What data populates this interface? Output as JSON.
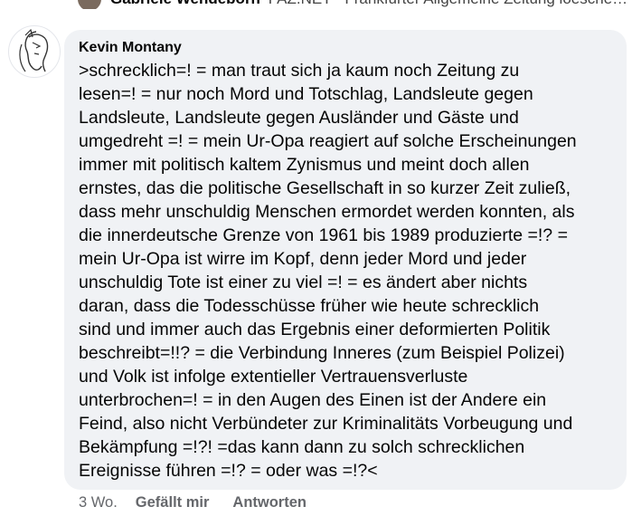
{
  "previous_comment": {
    "author": "Gabriele Wendeborn",
    "text": "FAZ.NET - Frankfurter Allgemeine Zeitung loeschen ist..."
  },
  "comment": {
    "author": "Kevin Montany",
    "paragraphs": [
      ">schrecklich=! = man traut sich ja kaum noch Zeitung zu",
      "lesen=! = nur noch Mord und Totschlag, Landsleute gegen",
      "Landsleute, Landsleute gegen Ausländer und Gäste und",
      "umgedreht =! = mein Ur-Opa reagiert auf solche Erscheinungen",
      "immer mit politisch kaltem Zynismus und meint doch allen",
      "ernstes, das die politische Gesellschaft in so kurzer Zeit zuließ,",
      "dass mehr unschuldig Menschen ermordet werden konnten, als",
      "die innerdeutsche Grenze von 1961 bis 1989 produzierte =!? =",
      "mein Ur-Opa ist wirre im Kopf, denn jeder Mord und jeder",
      "unschuldig Tote ist einer zu viel =! = es ändert aber nichts",
      "daran, dass die Todesschüsse früher wie heute schrecklich",
      "sind und immer auch das Ergebnis einer deformierten Politik",
      "beschreibt=!!? = die Verbindung Inneres (zum Beispiel Polizei)",
      "und Volk ist infolge extentieller Vertrauensverluste",
      "unterbrochen=! = in den Augen des Einen ist der Andere ein",
      "Feind, also nicht Verbündeter zur Kriminalitäts Vorbeugung und",
      "Bekämpfung =!?! =das kann dann zu solch schrecklichen",
      "Ereignisse führen =!? = oder was =!?<"
    ],
    "time": "3 Wo.",
    "like_label": "Gefällt mir",
    "reply_label": "Antworten"
  }
}
